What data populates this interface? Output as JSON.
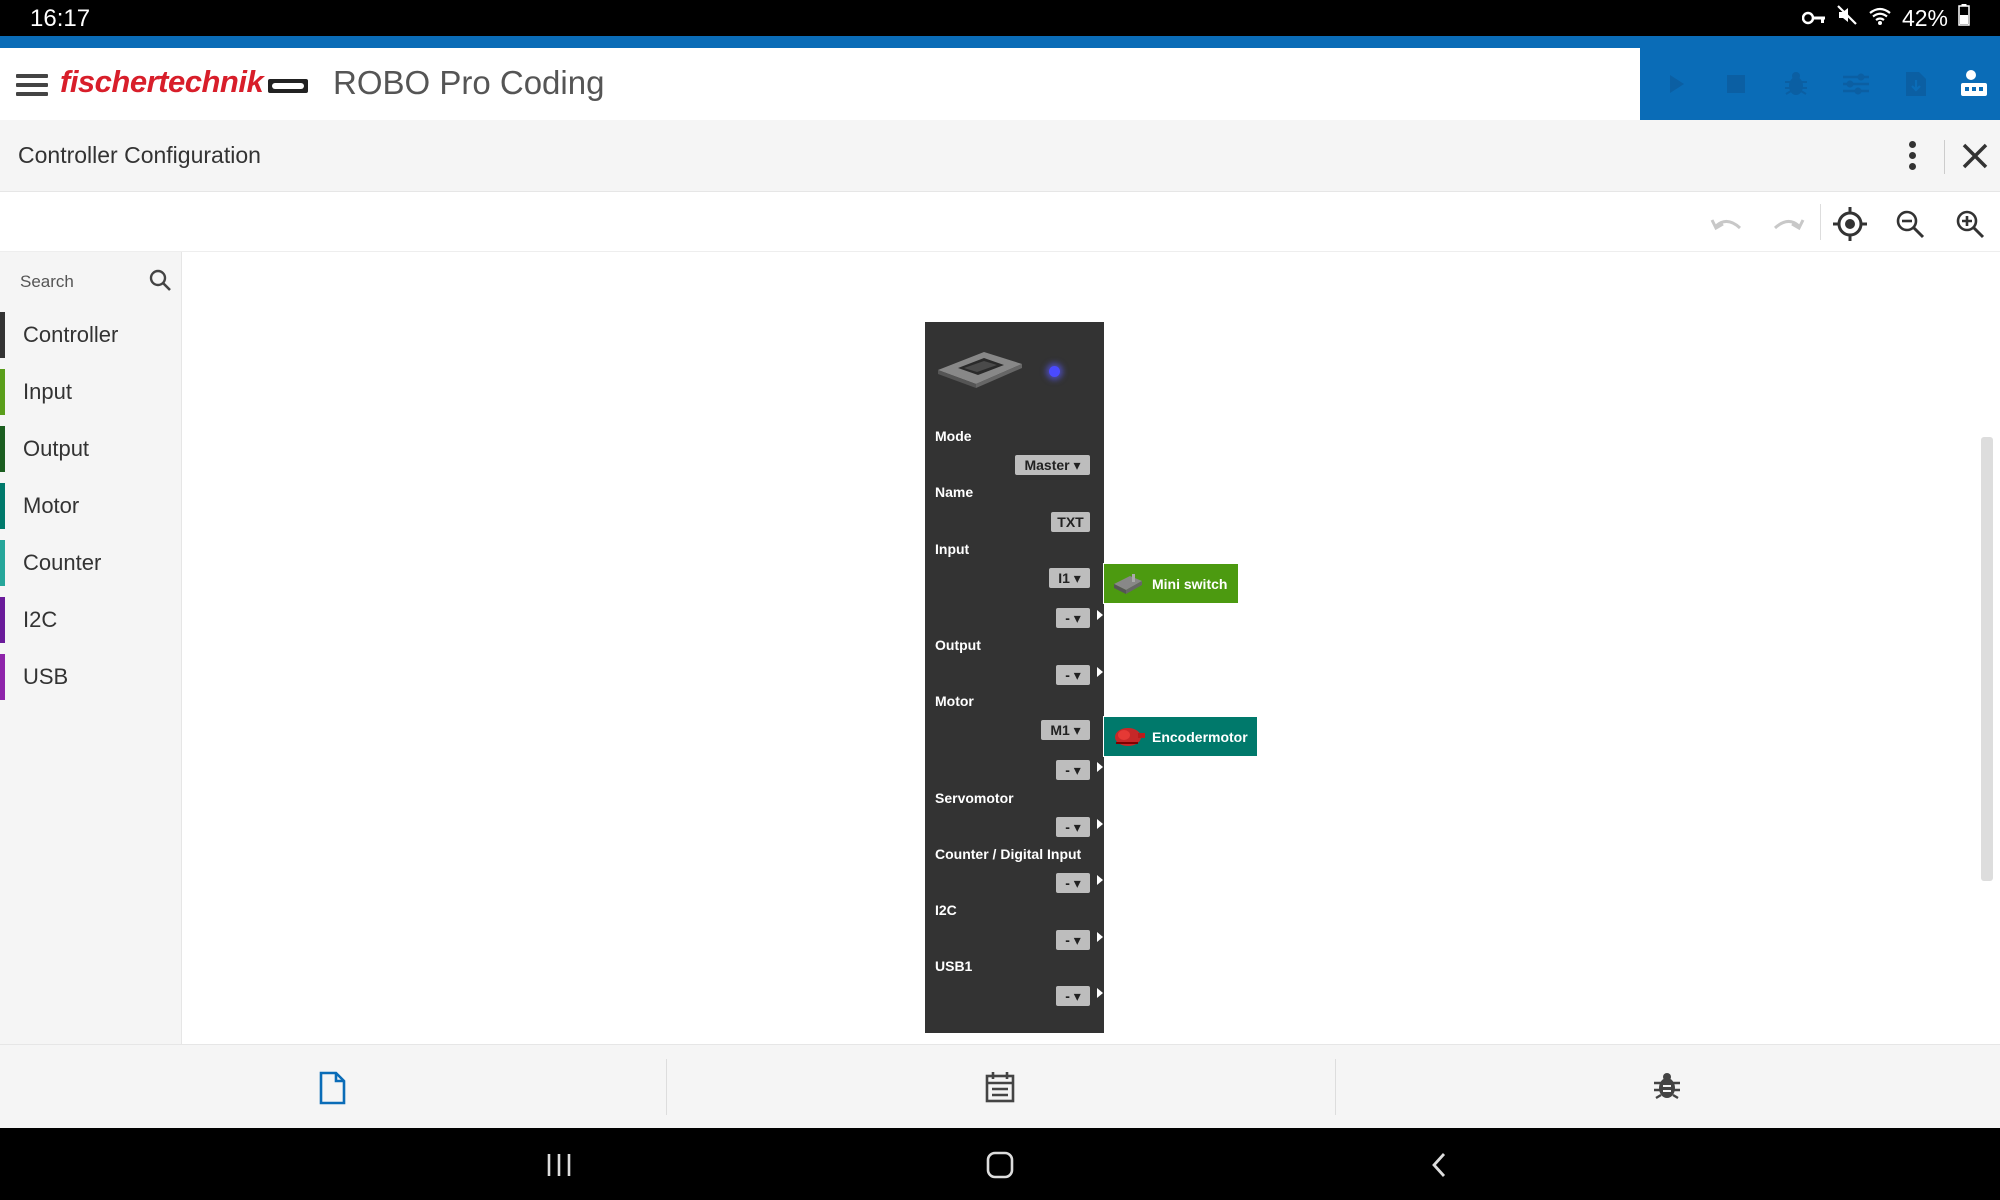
{
  "status_bar": {
    "time": "16:17",
    "battery": "42%"
  },
  "header": {
    "logo": "fischertechnik",
    "app_title": "ROBO Pro Coding"
  },
  "subheader": {
    "title": "Controller Configuration"
  },
  "sidebar": {
    "search_placeholder": "Search",
    "categories": [
      {
        "label": "Controller",
        "color": "#333333"
      },
      {
        "label": "Input",
        "color": "#5a9e1b"
      },
      {
        "label": "Output",
        "color": "#1b5e20"
      },
      {
        "label": "Motor",
        "color": "#00796b"
      },
      {
        "label": "Counter",
        "color": "#26a69a"
      },
      {
        "label": "I2C",
        "color": "#6a1b9a"
      },
      {
        "label": "USB",
        "color": "#8e24aa"
      }
    ]
  },
  "controller_block": {
    "labels": {
      "mode": "Mode",
      "name": "Name",
      "input": "Input",
      "output": "Output",
      "motor": "Motor",
      "servomotor": "Servomotor",
      "counter": "Counter / Digital Input",
      "i2c": "I2C",
      "usb1": "USB1"
    },
    "values": {
      "mode": "Master ▾",
      "name": "TXT",
      "input_1": "I1 ▾",
      "input_2": "- ▾",
      "output_1": "- ▾",
      "motor_1": "M1 ▾",
      "motor_2": "- ▾",
      "servo_1": "- ▾",
      "counter_1": "- ▾",
      "i2c_1": "- ▾",
      "usb1_1": "- ▾"
    }
  },
  "attached_blocks": {
    "mini_switch": {
      "label": "Mini switch",
      "color": "#4c9a10"
    },
    "encodermotor": {
      "label": "Encodermotor",
      "color": "#00796b"
    }
  },
  "colors": {
    "brand_red": "#d81e2a",
    "brand_blue": "#0a6cb7",
    "block_dark": "#333333"
  }
}
